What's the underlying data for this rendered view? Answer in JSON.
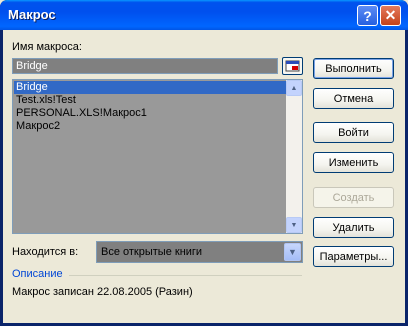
{
  "window": {
    "title": "Макрос",
    "help_glyph": "?",
    "close_glyph": "✕"
  },
  "macro_name": {
    "label": "Имя макроса:",
    "value": "Bridge"
  },
  "macro_list": {
    "items": [
      "Bridge",
      "Test.xls!Test",
      "PERSONAL.XLS!Макрос1",
      "Макрос2"
    ],
    "selected_index": 0
  },
  "location": {
    "label": "Находится в:",
    "value": "Все открытые книги"
  },
  "description": {
    "label": "Описание",
    "text": "Макрос записан 22.08.2005 (Разин)"
  },
  "buttons": {
    "run": "Выполнить",
    "cancel": "Отмена",
    "step_into": "Войти",
    "edit": "Изменить",
    "create": "Создать",
    "delete": "Удалить",
    "options": "Параметры..."
  },
  "colors": {
    "titlebar": "#0054e3",
    "selection": "#3169c6",
    "section_label": "#0046d5"
  },
  "icons": {
    "help": "help-icon",
    "close": "close-icon",
    "collapse": "collapse-dialog-icon"
  }
}
